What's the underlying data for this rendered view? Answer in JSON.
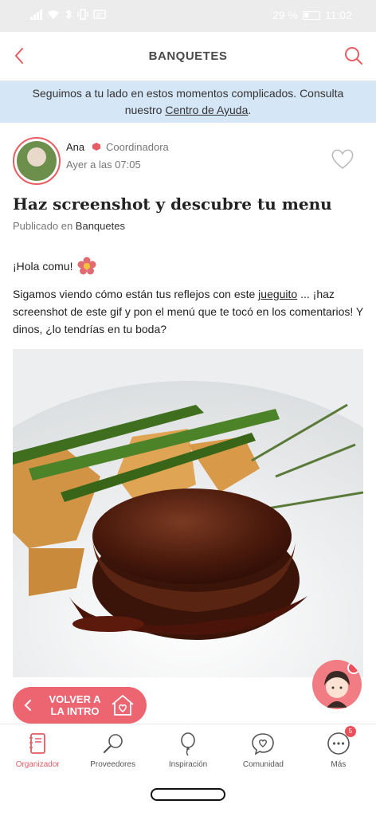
{
  "status_bar": {
    "battery": "29 %",
    "time": "11:02"
  },
  "header": {
    "title": "BANQUETES",
    "back_icon": "chevron-left-icon",
    "search_icon": "search-icon"
  },
  "notice": {
    "text_before": "Seguimos a tu lado en estos momentos complicados. Consulta nuestro ",
    "link": "Centro de Ayuda",
    "text_after": "."
  },
  "post": {
    "author": {
      "name": "Ana",
      "role": "Coordinadora",
      "time": "Ayer a las 07:05"
    },
    "title": "Haz screenshot y descubre tu menu",
    "published_prefix": "Publicado en",
    "published_category": "Banquetes",
    "greeting": "¡Hola comu!",
    "body_before": "Sigamos viendo cómo están tus reflejos con este ",
    "body_link": "jueguito",
    "body_after": " ... ¡haz screenshot de este gif y pon el menú que te tocó en los comentarios! Y dinos, ¿lo tendrías en tu boda?"
  },
  "floating": {
    "volver_line1": "VOLVER A",
    "volver_line2": "LA INTRO"
  },
  "tabbar": {
    "items": [
      {
        "label": "Organizador",
        "icon": "notebook-icon"
      },
      {
        "label": "Proveedores",
        "icon": "magnifier-icon"
      },
      {
        "label": "Inspiración",
        "icon": "balloon-icon"
      },
      {
        "label": "Comunidad",
        "icon": "chat-heart-icon"
      },
      {
        "label": "Más",
        "icon": "more-icon",
        "badge": "5"
      }
    ]
  },
  "colors": {
    "accent": "#e85c64",
    "notice_bg": "#d5e6f7"
  }
}
